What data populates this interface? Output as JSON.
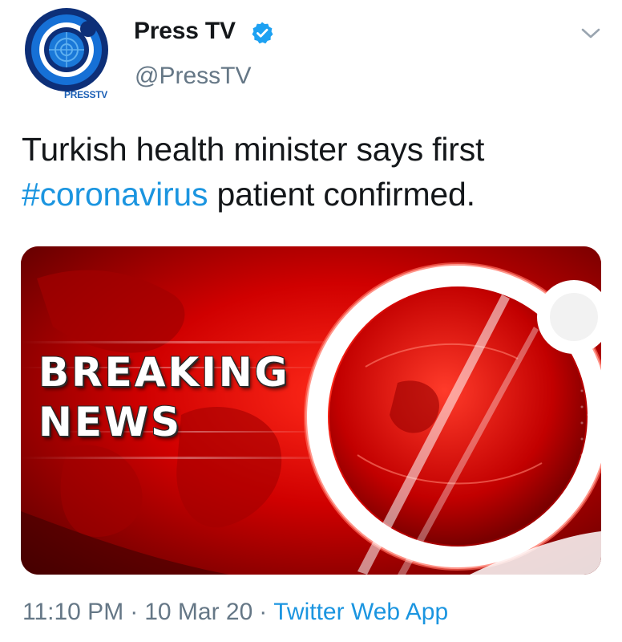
{
  "account": {
    "display_name": "Press TV",
    "handle": "@PressTV",
    "avatar_caption": "PRESSTV",
    "verified": true
  },
  "tweet": {
    "text_before": "Turkish health minister says first",
    "hashtag": "#coronavirus",
    "text_after": " patient confirmed.",
    "media": {
      "headline_line1": "BREAKING",
      "headline_line2": "NEWS"
    }
  },
  "meta": {
    "time": "11:10 PM",
    "date": "10 Mar 20",
    "separator": "·",
    "source": "Twitter Web App"
  },
  "colors": {
    "link": "#1b95e0",
    "secondary_text": "#657786",
    "primary_text": "#14171a",
    "media_red": "#c40000",
    "brand_blue": "#1b5fb5"
  },
  "icons": {
    "verified": "verified-badge-icon",
    "caret": "chevron-down-icon",
    "avatar": "presstv-logo-icon"
  }
}
